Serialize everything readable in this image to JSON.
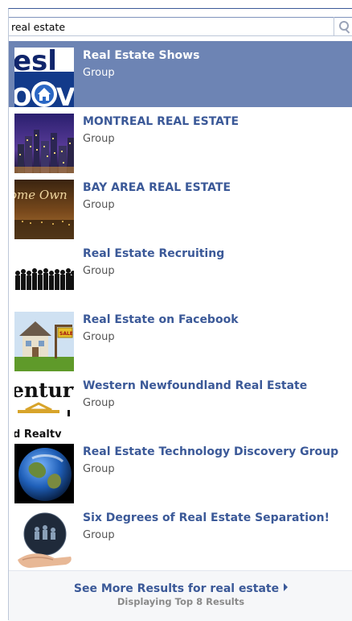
{
  "search": {
    "value": "real estate",
    "button_icon": "search-icon"
  },
  "results": [
    {
      "name": "Real Estate Shows",
      "type": "Group",
      "selected": true,
      "thumb_icon": "real-estate-now-logo"
    },
    {
      "name": "MONTREAL REAL ESTATE",
      "type": "Group",
      "thumb_icon": "city-night-skyline"
    },
    {
      "name": "BAY AREA REAL ESTATE",
      "type": "Group",
      "thumb_icon": "home-own-sunset"
    },
    {
      "name": "Real Estate Recruiting",
      "type": "Group",
      "thumb_icon": "crowd-silhouettes"
    },
    {
      "name": "Real Estate on Facebook",
      "type": "Group",
      "thumb_icon": "house-for-sale"
    },
    {
      "name": "Western Newfoundland Real Estate",
      "type": "Group",
      "thumb_icon": "century-21-logo",
      "logo_text": [
        "entury",
        "d Realty"
      ]
    },
    {
      "name": "Real Estate Technology Discovery Group",
      "type": "Group",
      "thumb_icon": "earth-globe"
    },
    {
      "name": "Six Degrees of Real Estate Separation!",
      "type": "Group",
      "thumb_icon": "globe-in-hand"
    }
  ],
  "footer": {
    "more_label": "See More Results for real estate",
    "count_note": "Displaying Top 8 Results"
  },
  "colors": {
    "selected_bg": "#6d84b4",
    "link": "#3b5998",
    "subtext": "#555555"
  }
}
